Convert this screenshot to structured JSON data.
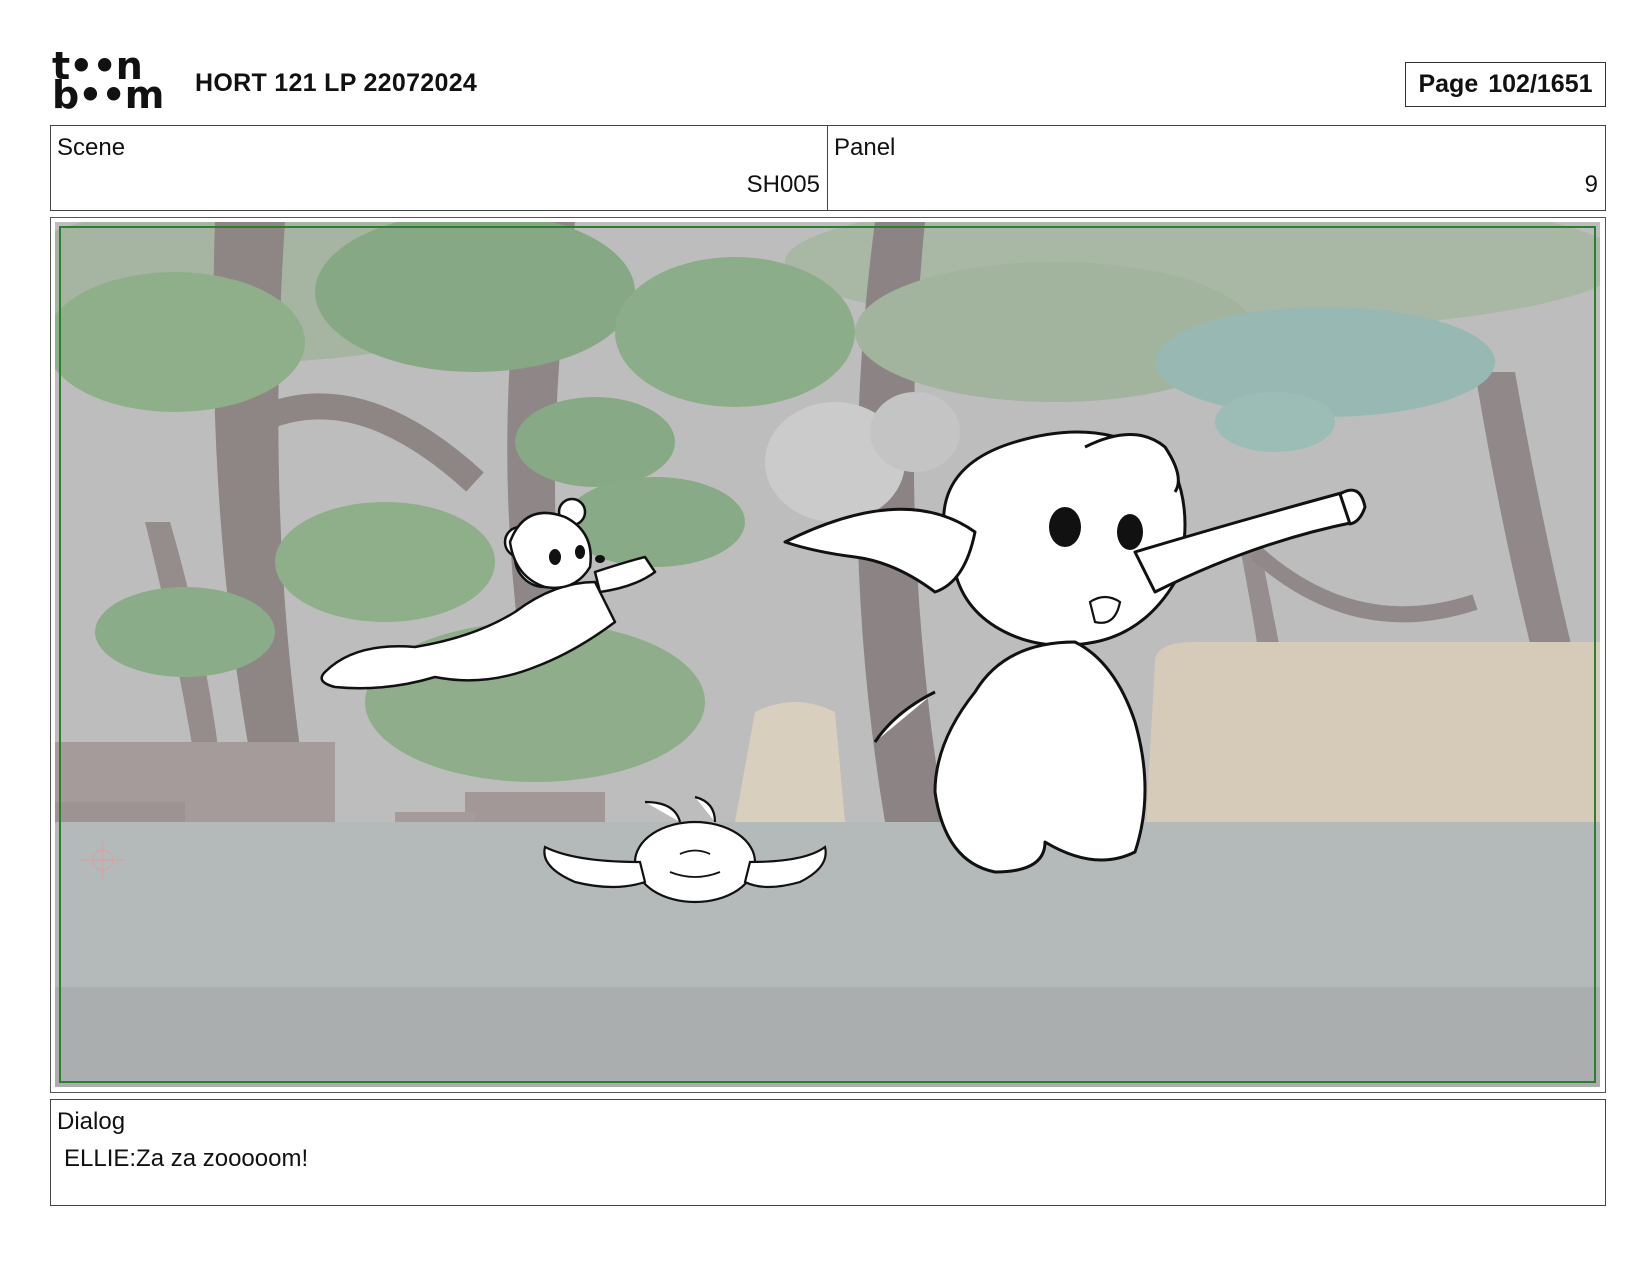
{
  "header": {
    "logo_line1": "t••n",
    "logo_line2": "b••m",
    "title": "HORT 121 LP 22072024",
    "page_label": "Page",
    "page_value": "102/1651"
  },
  "scene": {
    "label": "Scene",
    "value": "SH005"
  },
  "panel": {
    "label": "Panel",
    "value": "9"
  },
  "dialog": {
    "label": "Dialog",
    "text": "ELLIE:Za za zooooom!"
  }
}
